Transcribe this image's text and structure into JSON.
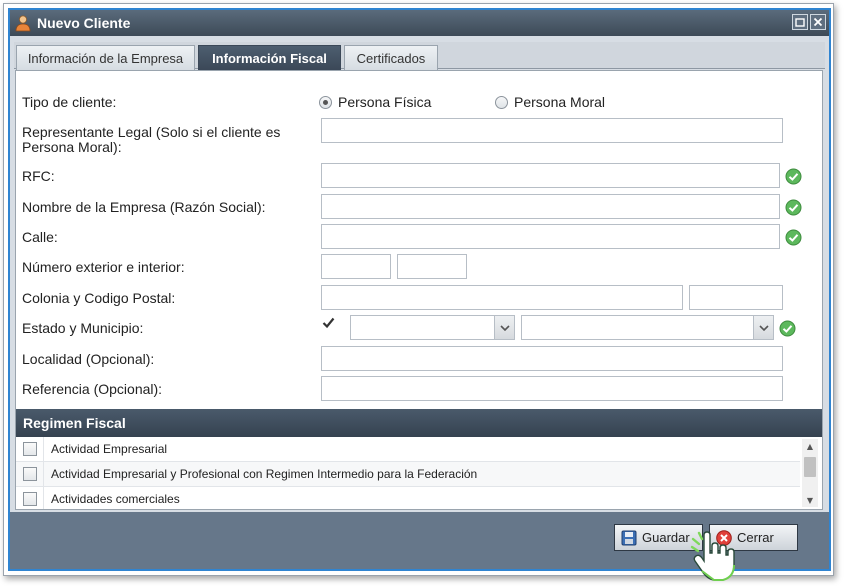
{
  "window": {
    "title": "Nuevo Cliente"
  },
  "tabs": [
    {
      "label": "Información de la Empresa",
      "active": false
    },
    {
      "label": "Información Fiscal",
      "active": true
    },
    {
      "label": "Certificados",
      "active": false
    }
  ],
  "form": {
    "tipo_cliente_label": "Tipo de cliente:",
    "radio_fisica": "Persona Física",
    "radio_moral": "Persona Moral",
    "radio_selected": "Persona Física",
    "representante_label_1": "Representante Legal (Solo si el cliente es",
    "representante_label_2": "Persona Moral):",
    "rfc_label": "RFC:",
    "nombre_label": "Nombre de la Empresa (Razón Social):",
    "calle_label": "Calle:",
    "numero_label": "Número exterior e interior:",
    "colonia_label": "Colonia y Codigo Postal:",
    "estado_label": "Estado y Municipio:",
    "localidad_label": "Localidad (Opcional):",
    "referencia_label": "Referencia (Opcional):",
    "estado_checkbox_checked": true
  },
  "regimen": {
    "header": "Regimen Fiscal",
    "items": [
      {
        "label": "Actividad Empresarial",
        "checked": false
      },
      {
        "label": "Actividad Empresarial y Profesional con Regimen Intermedio para la Federación",
        "checked": false
      },
      {
        "label": "Actividades comerciales",
        "checked": false
      }
    ]
  },
  "buttons": {
    "guardar": "Guardar",
    "cerrar": "Cerrar"
  },
  "colors": {
    "accent_border": "#2f84d1",
    "titlebar": "#3d4a57",
    "footer": "#66778a",
    "ok_green": "#5cb85c",
    "close_red": "#e0403a"
  }
}
